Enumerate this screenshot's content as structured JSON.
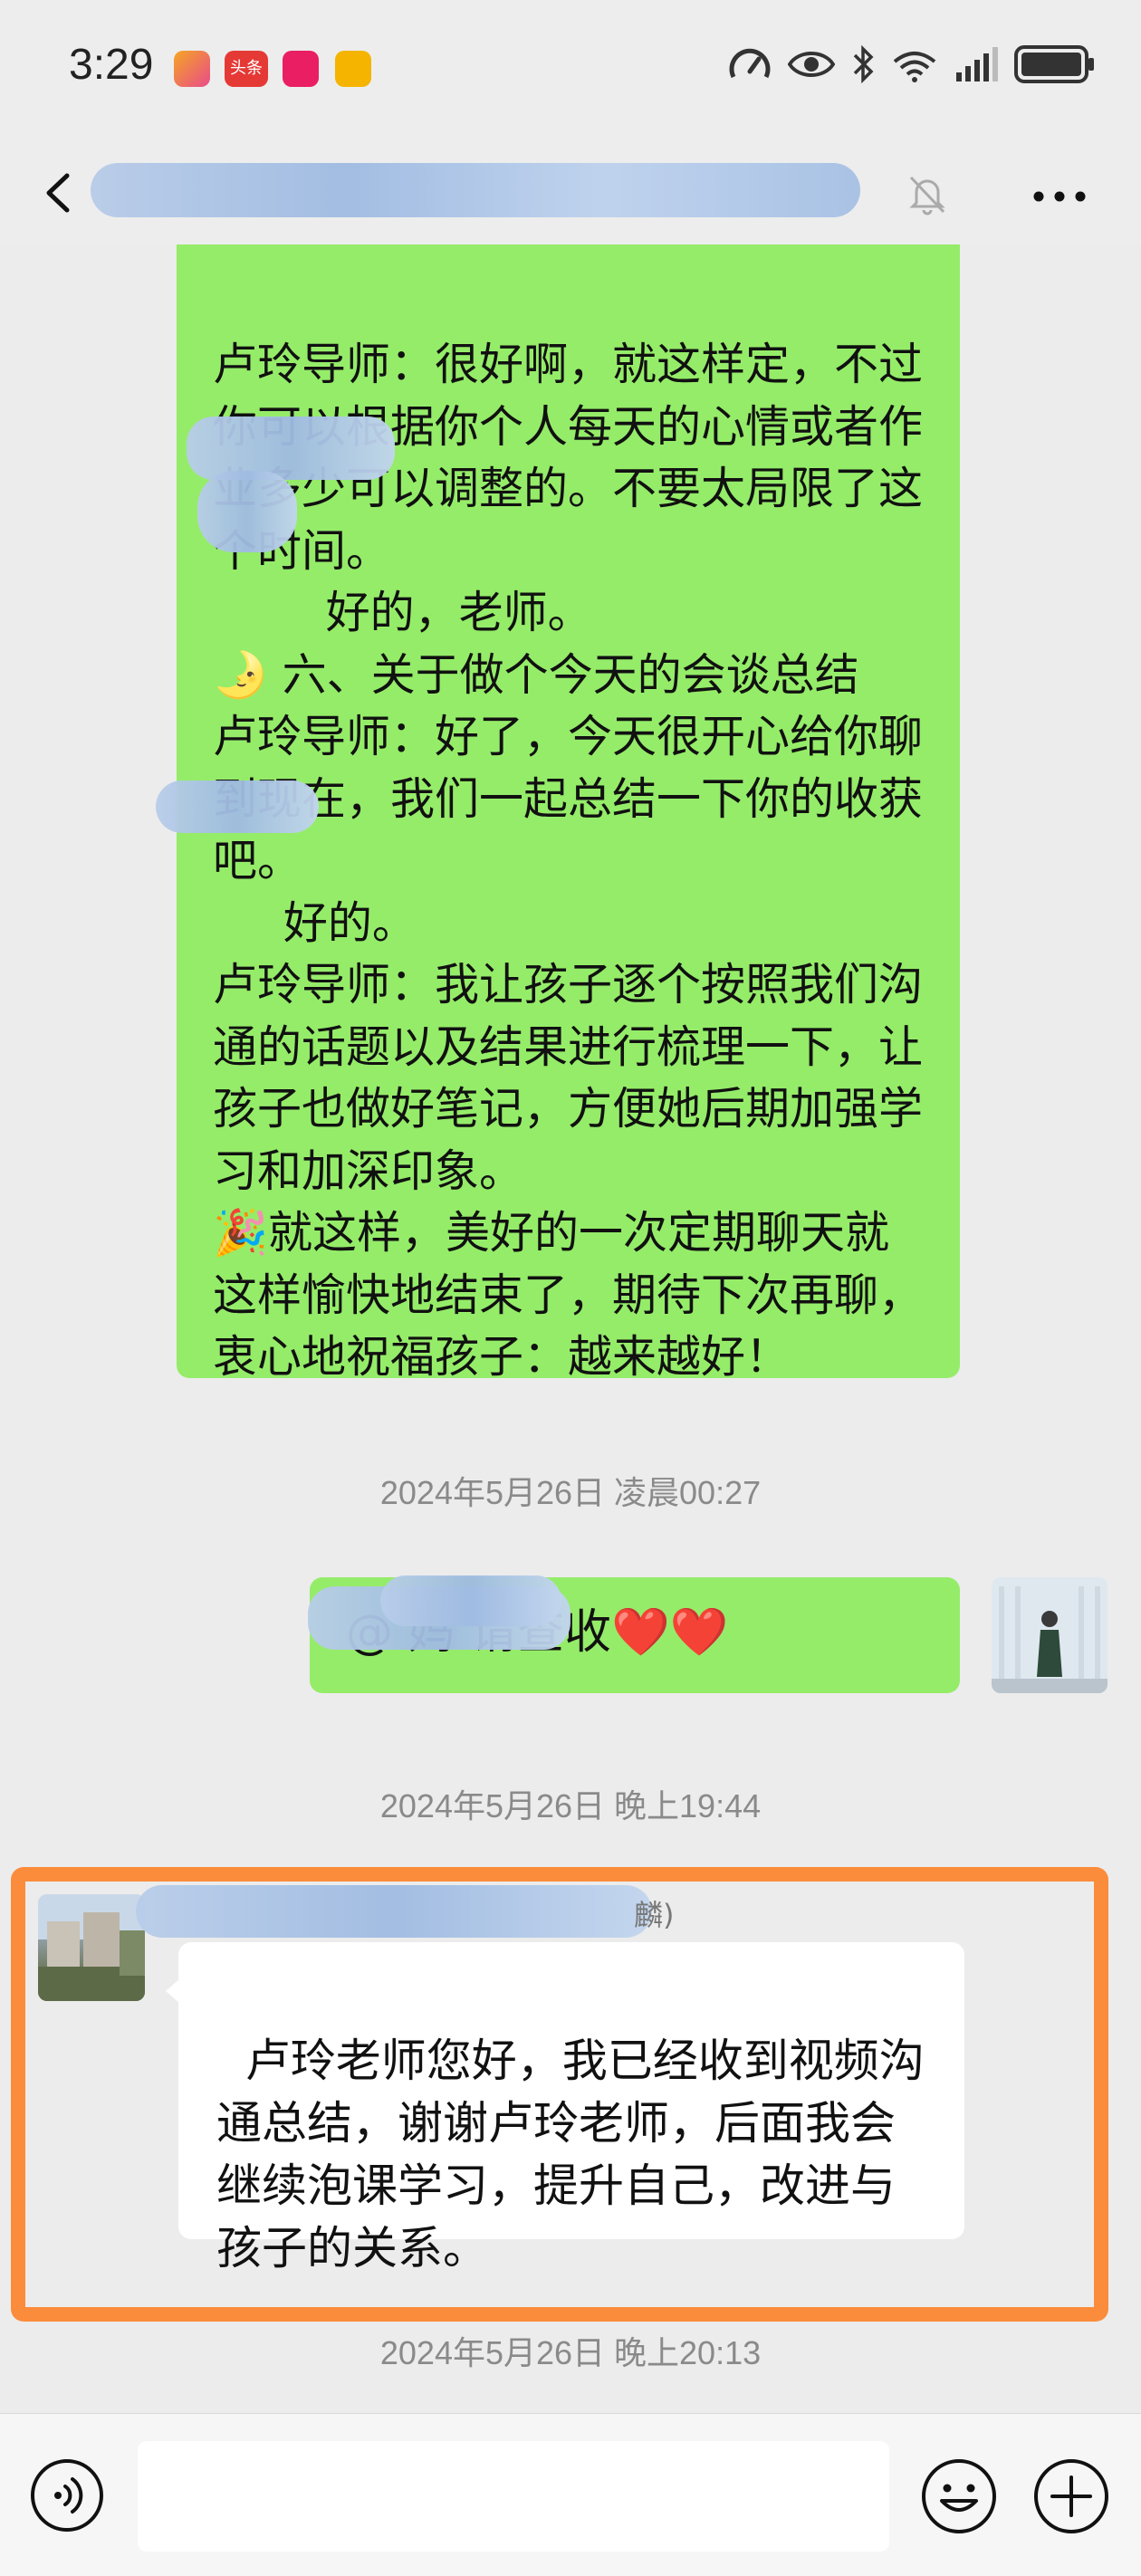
{
  "status_bar": {
    "time": "3:29",
    "apps": [
      {
        "icon": "tencent-app-icon",
        "color": "#f5a623",
        "label": ""
      },
      {
        "icon": "toutiao-app-icon",
        "color": "#e53935",
        "label": "头条"
      },
      {
        "icon": "shopping-app-icon",
        "color": "#e91e63",
        "label": ""
      },
      {
        "icon": "coupon-app-icon",
        "color": "#f4b400",
        "label": ""
      }
    ],
    "right_icons": [
      "data-speed-icon",
      "eye-icon",
      "bluetooth-icon",
      "wifi-6-icon",
      "signal-icon",
      "battery-icon"
    ]
  },
  "header": {
    "back_icon": "chevron-left-icon",
    "mute_icon": "bell-off-icon",
    "more_icon": "more-dots-icon"
  },
  "messages": {
    "long_message_text": "卢玲导师：很好啊，就这样定，不过你可以根据你个人每天的心情或者作业多少可以调整的。不要太局限了这个时间。\n        好的，老师。\n🌛 六、关于做个今天的会谈总结\n卢玲导师：好了，今天很开心给你聊到现在，我们一起总结一下你的收获吧。\n     好的。\n卢玲导师：我让孩子逐个按照我们沟通的话题以及结果进行梳理一下，让孩子也做好笔记，方便她后期加强学习和加深印象。\n🎉就这样，美好的一次定期聊天就这样愉快地结束了，期待下次再聊，衷心地祝福孩子：越来越好！\n🎉",
    "timestamp_1": "2024年5月26日 凌晨00:27",
    "sent_short_text": "@          妈  请查收❤️❤️",
    "timestamp_2": "2024年5月26日 晚上19:44",
    "sender_name_visible": "麟)",
    "reply_text": "卢玲老师您好，我已经收到视频沟通总结，谢谢卢玲老师，后面我会继续泡课学习，提升自己，改进与孩子的关系。",
    "timestamp_3": "2024年5月26日 晚上20:13"
  },
  "colors": {
    "sent_bubble": "#95ec69",
    "received_bubble": "#ffffff",
    "background": "#ececec",
    "highlight_border": "#fb8c3c"
  },
  "input_bar": {
    "voice_icon": "voice-icon",
    "input_value": "",
    "emoji_icon": "emoji-icon",
    "plus_icon": "plus-circle-icon"
  }
}
